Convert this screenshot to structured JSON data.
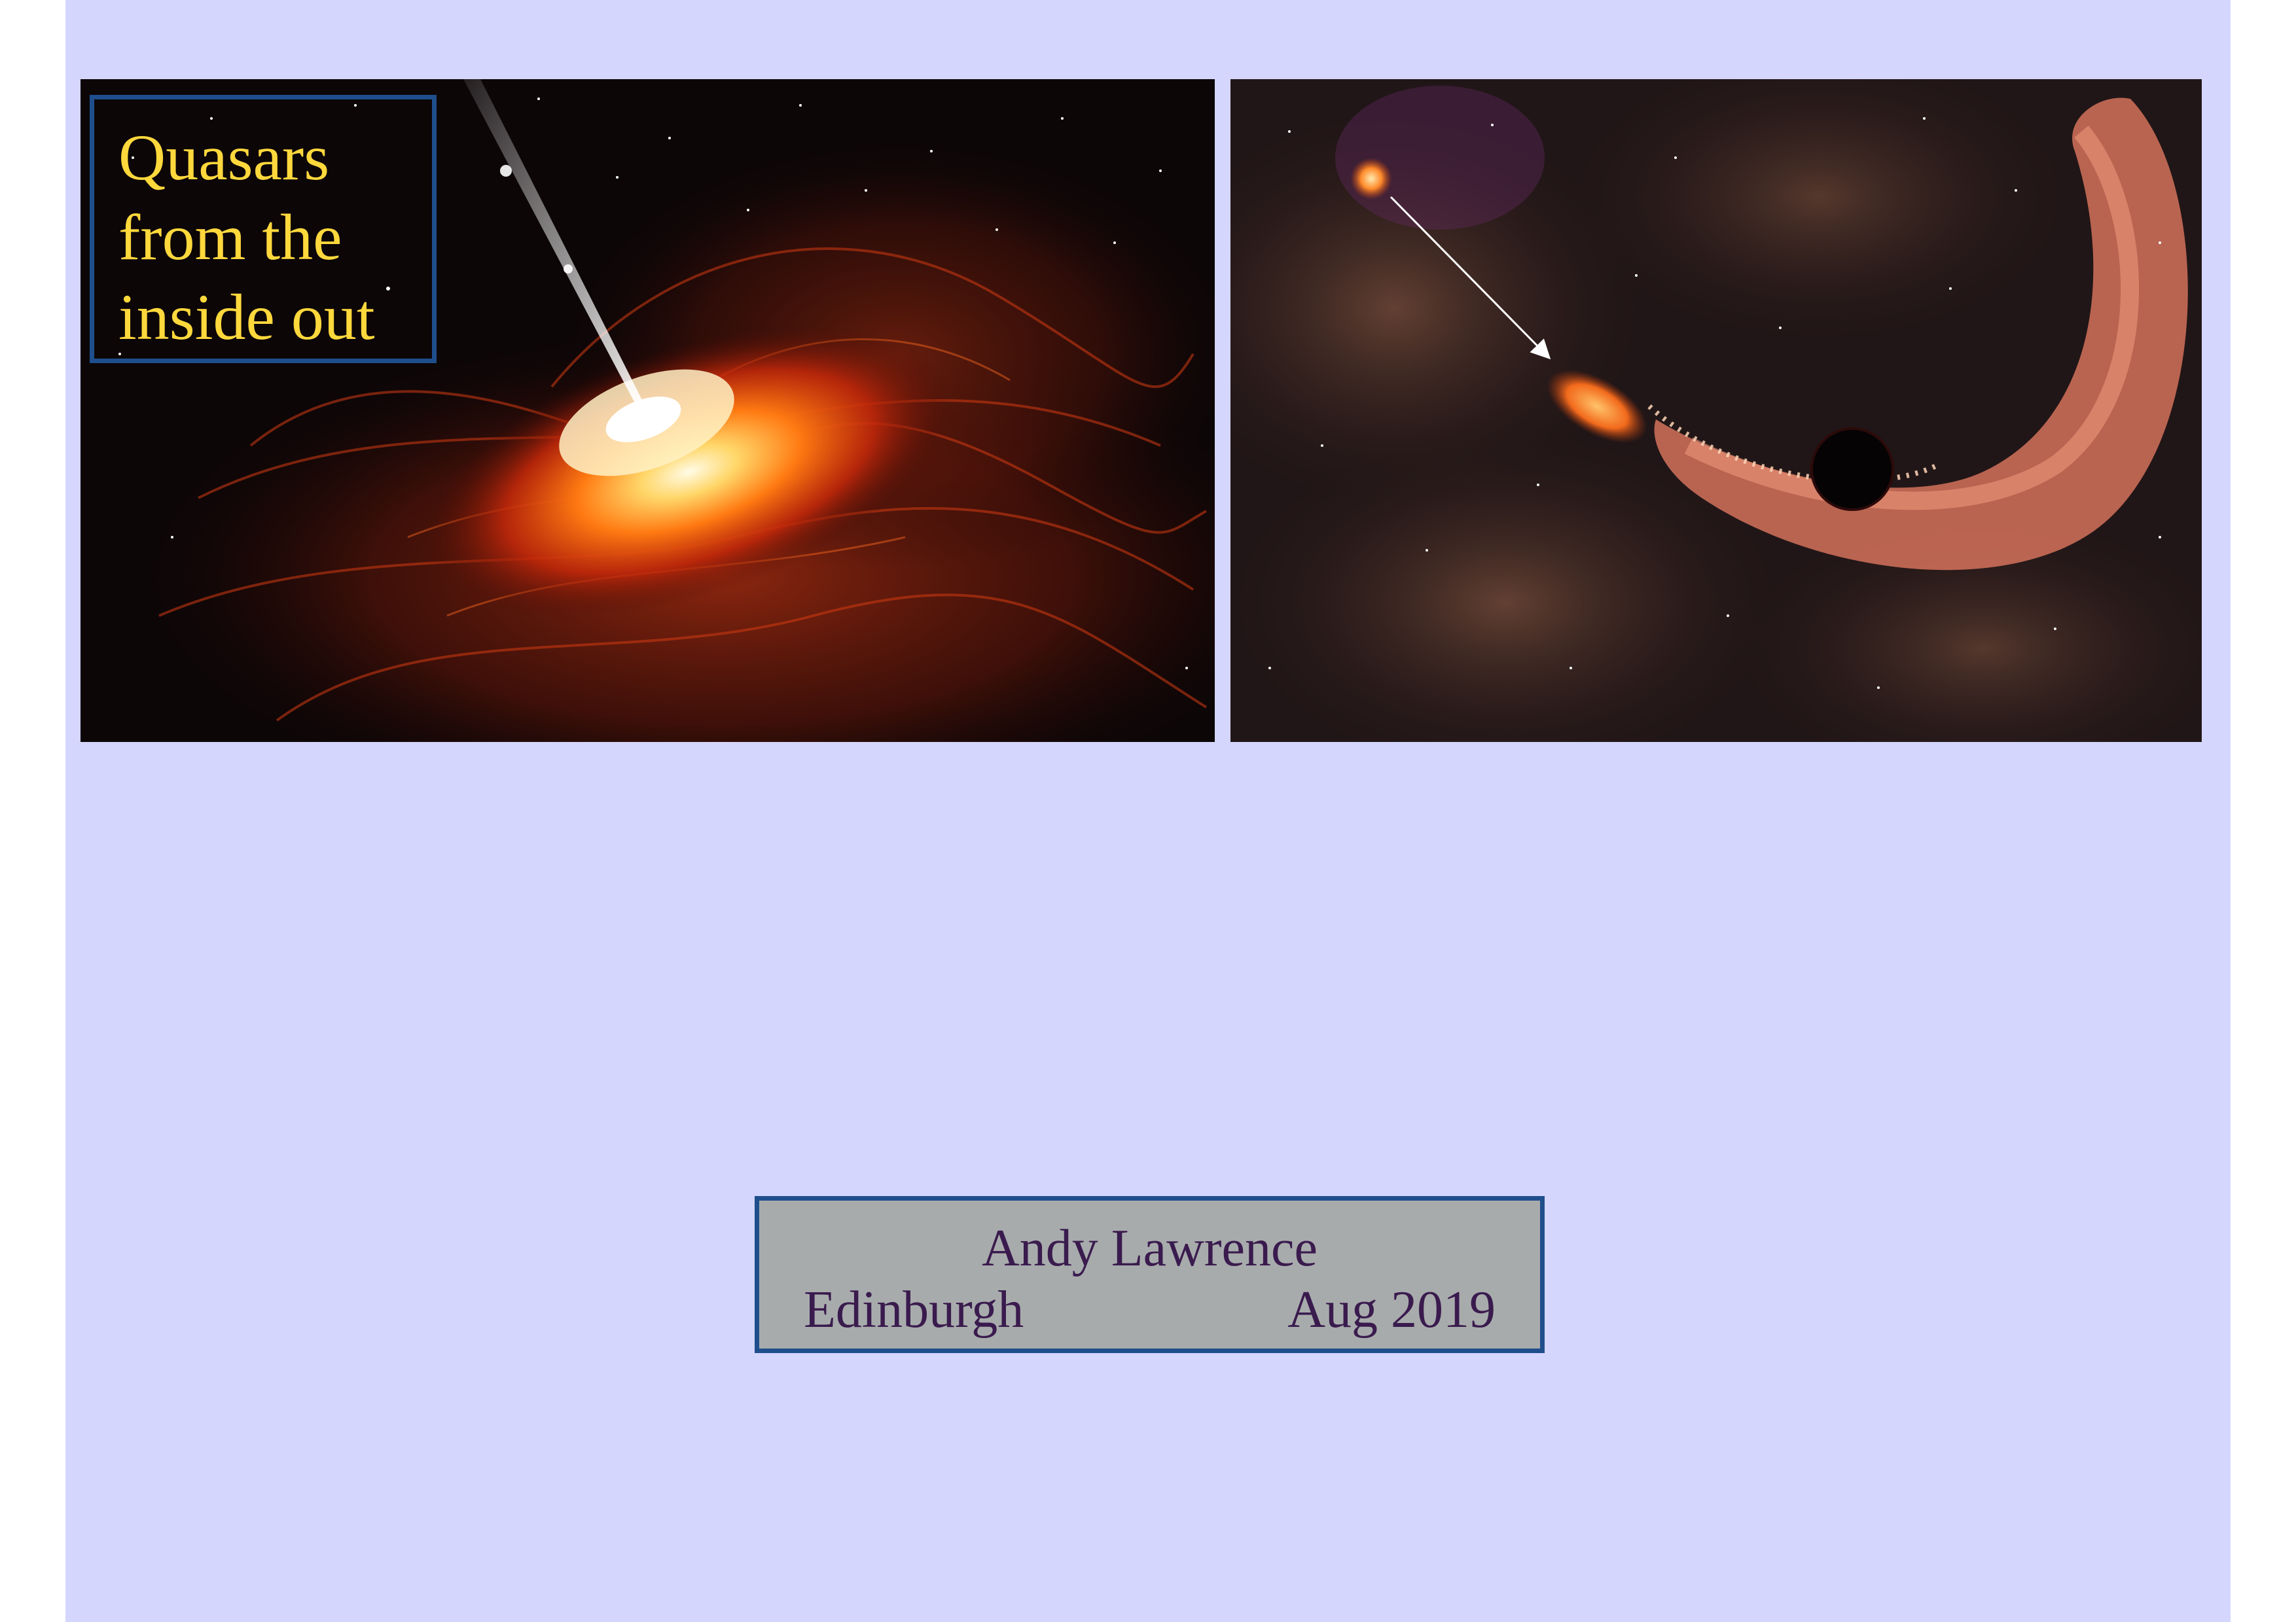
{
  "slide": {
    "background_color": "#d5d6fd",
    "accent_color": "#1f4e8c"
  },
  "title": {
    "lines": [
      "Quasars",
      "from the",
      "inside out"
    ],
    "text_color": "#ffd83c"
  },
  "images": {
    "left": {
      "subject": "quasar-accretion-disk-with-jet-illustration"
    },
    "right": {
      "subject": "star-disrupted-by-black-hole-illustration"
    }
  },
  "author_box": {
    "name": "Andy Lawrence",
    "place": "Edinburgh",
    "date": "Aug 2019",
    "background_color": "#a8abac",
    "text_color": "#3a1b4e"
  }
}
